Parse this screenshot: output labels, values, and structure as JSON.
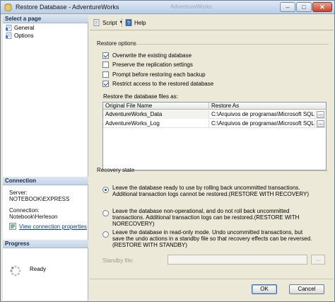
{
  "window": {
    "title": "Restore Database - AdventureWorks",
    "background_title": "AdventureWorks"
  },
  "left_pane": {
    "select_page_header": "Select a page",
    "pages": [
      {
        "label": "General",
        "icon": "page-icon"
      },
      {
        "label": "Options",
        "icon": "page-icon"
      }
    ],
    "connection_header": "Connection",
    "server_label": "Server:",
    "server_value": "NOTEBOOK\\EXPRESS",
    "connection_label": "Connection:",
    "connection_value": "Notebook\\Herleson",
    "view_connection_properties": "View connection properties",
    "progress_header": "Progress",
    "progress_status": "Ready"
  },
  "toolbar": {
    "script_label": "Script",
    "help_label": "Help"
  },
  "restore_options": {
    "header": "Restore options",
    "checkboxes": [
      {
        "label": "Overwrite the existing database",
        "checked": true
      },
      {
        "label": "Preserve the replication settings",
        "checked": false
      },
      {
        "label": "Prompt before restoring each backup",
        "checked": false
      },
      {
        "label": "Restrict access to the restored database",
        "checked": true
      }
    ]
  },
  "files": {
    "label": "Restore the database files as:",
    "columns": [
      "Original File Name",
      "Restore As"
    ],
    "rows": [
      {
        "original": "AdventureWorks_Data",
        "restore_as": "C:\\Arquivos de programas\\Microsoft SQL ..."
      },
      {
        "original": "AdventureWorks_Log",
        "restore_as": "C:\\Arquivos de programas\\Microsoft SQL ..."
      }
    ],
    "browse_label": "..."
  },
  "recovery_state": {
    "header": "Recovery state",
    "options": [
      {
        "text": "Leave the database ready to use by rolling back uncommitted transactions. Additional transaction logs cannot be restored.(RESTORE WITH RECOVERY)",
        "selected": true
      },
      {
        "text": "Leave the database non-operational, and do not roll back uncommitted transactions. Additional transaction logs can be restored.(RESTORE WITH NORECOVERY)",
        "selected": false
      },
      {
        "text": "Leave the database in read-only mode. Undo uncommitted transactions, but save the undo actions in a standby file so that recovery effects can be reversed.(RESTORE WITH STANDBY)",
        "selected": false
      }
    ],
    "standby_label": "Standby file:",
    "standby_value": "",
    "standby_browse": "..."
  },
  "footer": {
    "ok_label": "OK",
    "cancel_label": "Cancel"
  },
  "colors": {
    "accent": "#3a6ea5",
    "panel": "#ece9d8",
    "link": "#0b3b9a"
  }
}
